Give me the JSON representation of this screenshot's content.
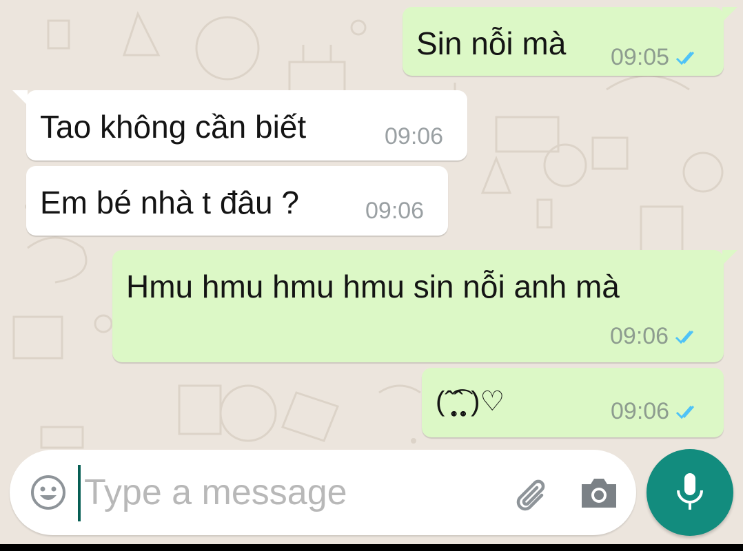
{
  "colors": {
    "wallpaper": "#ece5dd",
    "outgoing_bubble": "#dcf8c6",
    "incoming_bubble": "#ffffff",
    "read_ticks": "#4fc3f7",
    "mic_button": "#128c7e",
    "caret": "#075e54"
  },
  "messages": [
    {
      "direction": "outgoing",
      "text": "Sin nỗi mà",
      "time": "09:05",
      "status_icon": "double-check-icon"
    },
    {
      "direction": "incoming",
      "text": "Tao không cần biết",
      "time": "09:06"
    },
    {
      "direction": "incoming",
      "text": "Em bé nhà t đâu ?",
      "time": "09:06"
    },
    {
      "direction": "outgoing",
      "text": "Hmu hmu hmu hmu sin nỗi anh mà",
      "time": "09:06",
      "status_icon": "double-check-icon"
    },
    {
      "direction": "outgoing",
      "text": "(ˆ̩̥̩̥̩̥̩̩̥͡ˆ̩̥̩̥̩̥̩̩̥ )♡",
      "time": "09:06",
      "status_icon": "double-check-icon"
    }
  ],
  "composer": {
    "placeholder": "Type a message",
    "icons": [
      "smiley-icon",
      "paperclip-icon",
      "camera-icon",
      "microphone-icon"
    ]
  }
}
